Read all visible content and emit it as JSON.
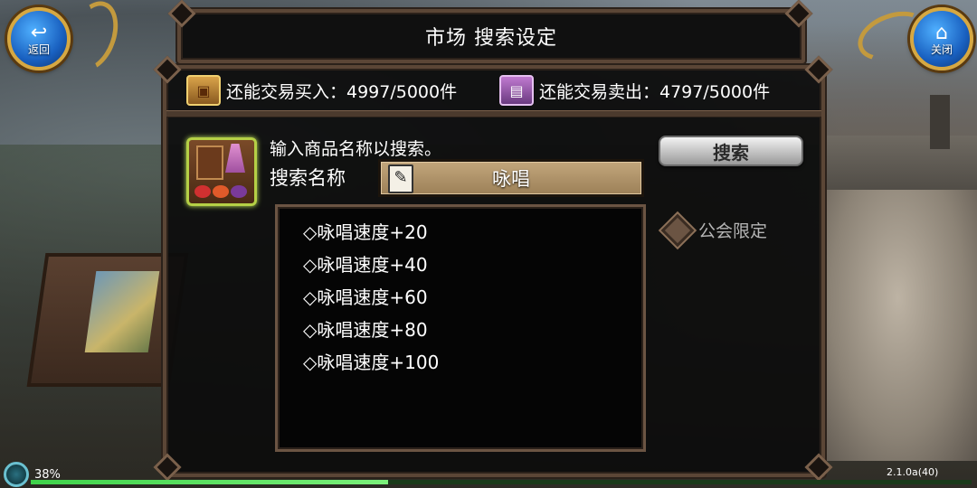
{
  "header": {
    "title": "市场 搜索设定",
    "back_label": "返回",
    "close_label": "关闭"
  },
  "trade_limits": {
    "buy_label": "还能交易买入：4997/5000件",
    "sell_label": "还能交易卖出：4797/5000件"
  },
  "search": {
    "hint": "输入商品名称以搜索。",
    "name_label": "搜索名称",
    "value": "咏唱",
    "button_label": "搜索"
  },
  "results": [
    "◇咏唱速度+20",
    "◇咏唱速度+40",
    "◇咏唱速度+60",
    "◇咏唱速度+80",
    "◇咏唱速度+100"
  ],
  "guild_filter": {
    "label": "公会限定"
  },
  "status": {
    "battery": "38%",
    "battery_level": 0.38,
    "version": "2.1.0a(40)"
  },
  "colors": {
    "corner_button": "#1960c0",
    "gold_frame": "#d6a842",
    "panel_frame": "#5b4636",
    "search_field": "#b3966c",
    "progress_fill": "#3fd24a"
  },
  "icons": {
    "back": "return-arrow-icon",
    "close": "home-icon",
    "buy": "treasure-chest-icon",
    "sell": "merchant-stall-icon",
    "market": "market-stall-icon",
    "note": "clipboard-icon",
    "guild": "diamond-icon"
  }
}
